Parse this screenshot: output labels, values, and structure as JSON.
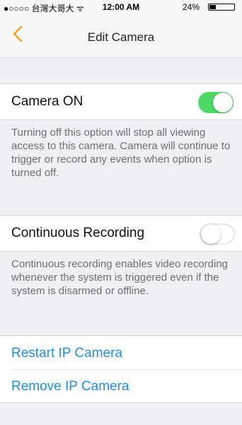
{
  "status_bar": {
    "carrier": "●○○○○ 台灣大哥大 ᯤ",
    "time": "12:00 AM",
    "battery_percent": "24%",
    "battery_level": 0.24
  },
  "nav": {
    "back_icon": "chevron-left-icon",
    "title": "Edit Camera",
    "accent_color": "#ff9500"
  },
  "camera_on": {
    "label": "Camera ON",
    "enabled": true,
    "description": "Turning off this option will stop all viewing access to this camera. Camera will continue to trigger or record any events when option is turned off."
  },
  "continuous_recording": {
    "label": "Continuous Recording",
    "enabled": false,
    "description": "Continuous recording enables video recording whenever the system is triggered even if the system is disarmed or offline."
  },
  "actions": {
    "restart": "Restart IP Camera",
    "remove": "Remove IP Camera",
    "link_color": "#1e8ded"
  },
  "colors": {
    "toggle_on": "#4cd964",
    "background": "#efeff4"
  }
}
